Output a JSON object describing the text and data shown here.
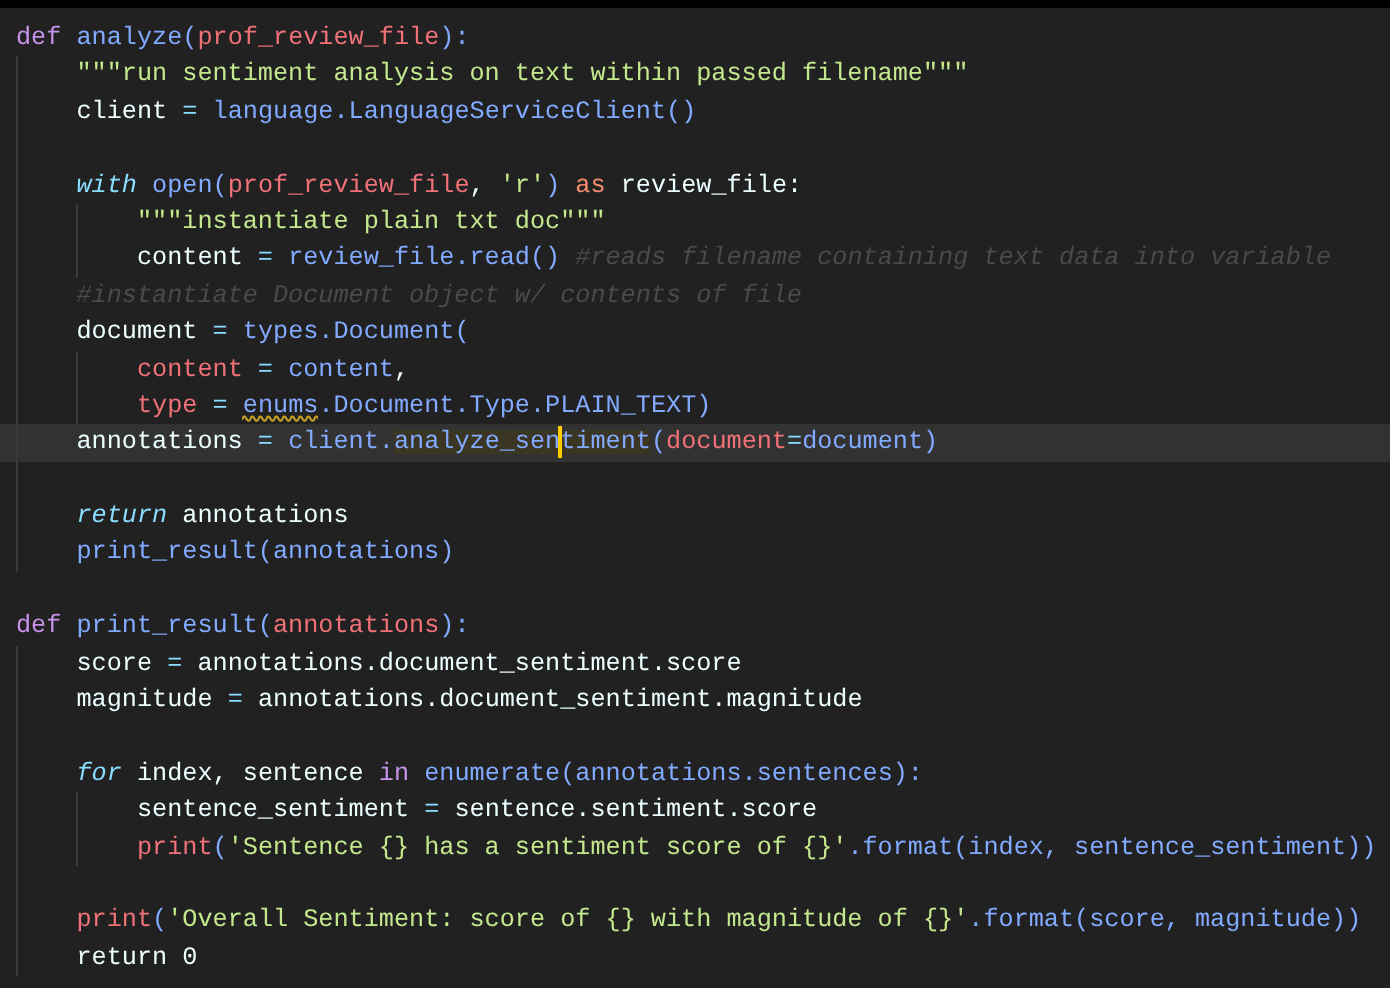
{
  "editor": {
    "lines": [
      {
        "current": false,
        "tokens": [
          {
            "t": "def",
            "kind": "keyword"
          },
          {
            "t": " analyze(",
            "kind": "function"
          },
          {
            "t": "prof_review_file",
            "kind": "param"
          },
          {
            "t": "):",
            "kind": "function"
          }
        ]
      },
      {
        "current": false,
        "tokens": [
          {
            "t": "    \"\"\"run sentiment analysis on text within passed filename\"\"\"",
            "kind": "string"
          }
        ]
      },
      {
        "current": false,
        "tokens": [
          {
            "t": "    client",
            "kind": "name"
          },
          {
            "t": " = ",
            "kind": "operator"
          },
          {
            "t": "language.LanguageServiceClient()",
            "kind": "function"
          }
        ]
      },
      {
        "current": false
      },
      {
        "current": false,
        "tokens": [
          {
            "t": "    with",
            "kind": "control"
          },
          {
            "t": " open(",
            "kind": "function"
          },
          {
            "t": "prof_review_file",
            "kind": "param"
          },
          {
            "t": ", ",
            "kind": "name"
          },
          {
            "t": "'r'",
            "kind": "string"
          },
          {
            "t": ")",
            "kind": "function"
          },
          {
            "t": " as",
            "kind": "alias"
          },
          {
            "t": " review_file:",
            "kind": "name"
          }
        ]
      },
      {
        "current": false,
        "tokens": [
          {
            "t": "        \"\"\"instantiate plain txt doc\"\"\"",
            "kind": "string"
          }
        ]
      },
      {
        "current": false,
        "tokens": [
          {
            "t": "        content",
            "kind": "name"
          },
          {
            "t": " = ",
            "kind": "operator"
          },
          {
            "t": "review_file.read()",
            "kind": "function"
          },
          {
            "t": " #reads filename containing text data into variable",
            "kind": "comment"
          }
        ]
      },
      {
        "current": false,
        "tokens": [
          {
            "t": "    #instantiate Document object w/ contents of file",
            "kind": "comment"
          }
        ]
      },
      {
        "current": false,
        "tokens": [
          {
            "t": "    document",
            "kind": "name"
          },
          {
            "t": " = ",
            "kind": "operator"
          },
          {
            "t": "types.Document(",
            "kind": "function"
          }
        ]
      },
      {
        "current": false,
        "tokens": [
          {
            "t": "        content",
            "kind": "param"
          },
          {
            "t": " = ",
            "kind": "operator"
          },
          {
            "t": "content",
            "kind": "function"
          },
          {
            "t": ",",
            "kind": "name"
          }
        ]
      },
      {
        "current": false,
        "tokens": [
          {
            "t": "        type",
            "kind": "param"
          },
          {
            "t": " = ",
            "kind": "operator"
          },
          {
            "t": "enums",
            "kind": "function",
            "warning": true
          },
          {
            "t": ".Document.Type.PLAIN_TEXT)",
            "kind": "function"
          }
        ]
      },
      {
        "current": true,
        "tokens": [
          {
            "t": "    annotations",
            "kind": "name"
          },
          {
            "t": " = ",
            "kind": "operator"
          },
          {
            "t": "client.",
            "kind": "function"
          },
          {
            "t": "analyze_sen",
            "kind": "function",
            "highlight": true,
            "cursor_after": true
          },
          {
            "t": "timent",
            "kind": "function",
            "highlight": true
          },
          {
            "t": "(",
            "kind": "function"
          },
          {
            "t": "document",
            "kind": "param"
          },
          {
            "t": "=",
            "kind": "operator"
          },
          {
            "t": "document)",
            "kind": "function"
          }
        ]
      },
      {
        "current": false
      },
      {
        "current": false,
        "tokens": [
          {
            "t": "    return",
            "kind": "control"
          },
          {
            "t": " annotations",
            "kind": "name"
          }
        ]
      },
      {
        "current": false,
        "tokens": [
          {
            "t": "    print_result(annotations)",
            "kind": "function"
          }
        ]
      },
      {
        "current": false
      },
      {
        "current": false,
        "tokens": [
          {
            "t": "def",
            "kind": "keyword"
          },
          {
            "t": " print_result(",
            "kind": "function"
          },
          {
            "t": "annotations",
            "kind": "param"
          },
          {
            "t": "):",
            "kind": "function"
          }
        ]
      },
      {
        "current": false,
        "tokens": [
          {
            "t": "    score",
            "kind": "name"
          },
          {
            "t": " = ",
            "kind": "operator"
          },
          {
            "t": "annotations.document_sentiment.score",
            "kind": "name"
          }
        ]
      },
      {
        "current": false,
        "tokens": [
          {
            "t": "    magnitude",
            "kind": "name"
          },
          {
            "t": " = ",
            "kind": "operator"
          },
          {
            "t": "annotations.document_sentiment.magnitude",
            "kind": "name"
          }
        ]
      },
      {
        "current": false
      },
      {
        "current": false,
        "tokens": [
          {
            "t": "    for",
            "kind": "control"
          },
          {
            "t": " index, sentence ",
            "kind": "name"
          },
          {
            "t": "in",
            "kind": "keyword"
          },
          {
            "t": " enumerate(annotations.sentences):",
            "kind": "function"
          }
        ]
      },
      {
        "current": false,
        "tokens": [
          {
            "t": "        sentence_sentiment",
            "kind": "name"
          },
          {
            "t": " = ",
            "kind": "operator"
          },
          {
            "t": "sentence.sentiment.score",
            "kind": "name"
          }
        ]
      },
      {
        "current": false,
        "tokens": [
          {
            "t": "        print",
            "kind": "param"
          },
          {
            "t": "(",
            "kind": "function"
          },
          {
            "t": "'Sentence {} has a sentiment score of {}'",
            "kind": "string"
          },
          {
            "t": ".format(index, sentence_sentiment))",
            "kind": "function"
          }
        ]
      },
      {
        "current": false
      },
      {
        "current": false,
        "tokens": [
          {
            "t": "    print",
            "kind": "param"
          },
          {
            "t": "(",
            "kind": "function"
          },
          {
            "t": "'Overall Sentiment: score of {} with magnitude of {}'",
            "kind": "string"
          },
          {
            "t": ".format(score, magnitude))",
            "kind": "function"
          }
        ]
      },
      {
        "current": false,
        "tokens": [
          {
            "t": "    return 0",
            "kind": "name"
          }
        ]
      }
    ]
  }
}
